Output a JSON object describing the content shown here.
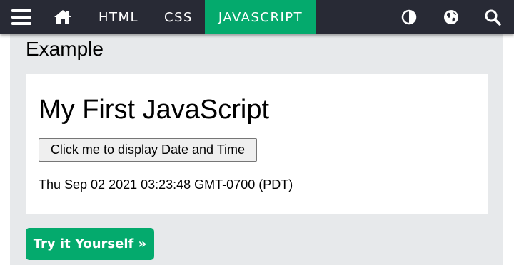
{
  "nav": {
    "links": [
      {
        "label": "HTML"
      },
      {
        "label": "CSS"
      },
      {
        "label": "JAVASCRIPT"
      }
    ],
    "icons": [
      "menu-icon",
      "home-icon",
      "contrast-icon",
      "globe-icon",
      "search-icon"
    ]
  },
  "example": {
    "title": "Example",
    "heading": "My First JavaScript",
    "button_label": "Click me to display Date and Time",
    "output_text": "Thu Sep 02 2021 03:23:48 GMT-0700 (PDT)",
    "try_label": "Try it Yourself »"
  },
  "colors": {
    "nav_bg": "#282a35",
    "accent": "#04aa6d",
    "panel_bg": "#e7e9eb"
  }
}
